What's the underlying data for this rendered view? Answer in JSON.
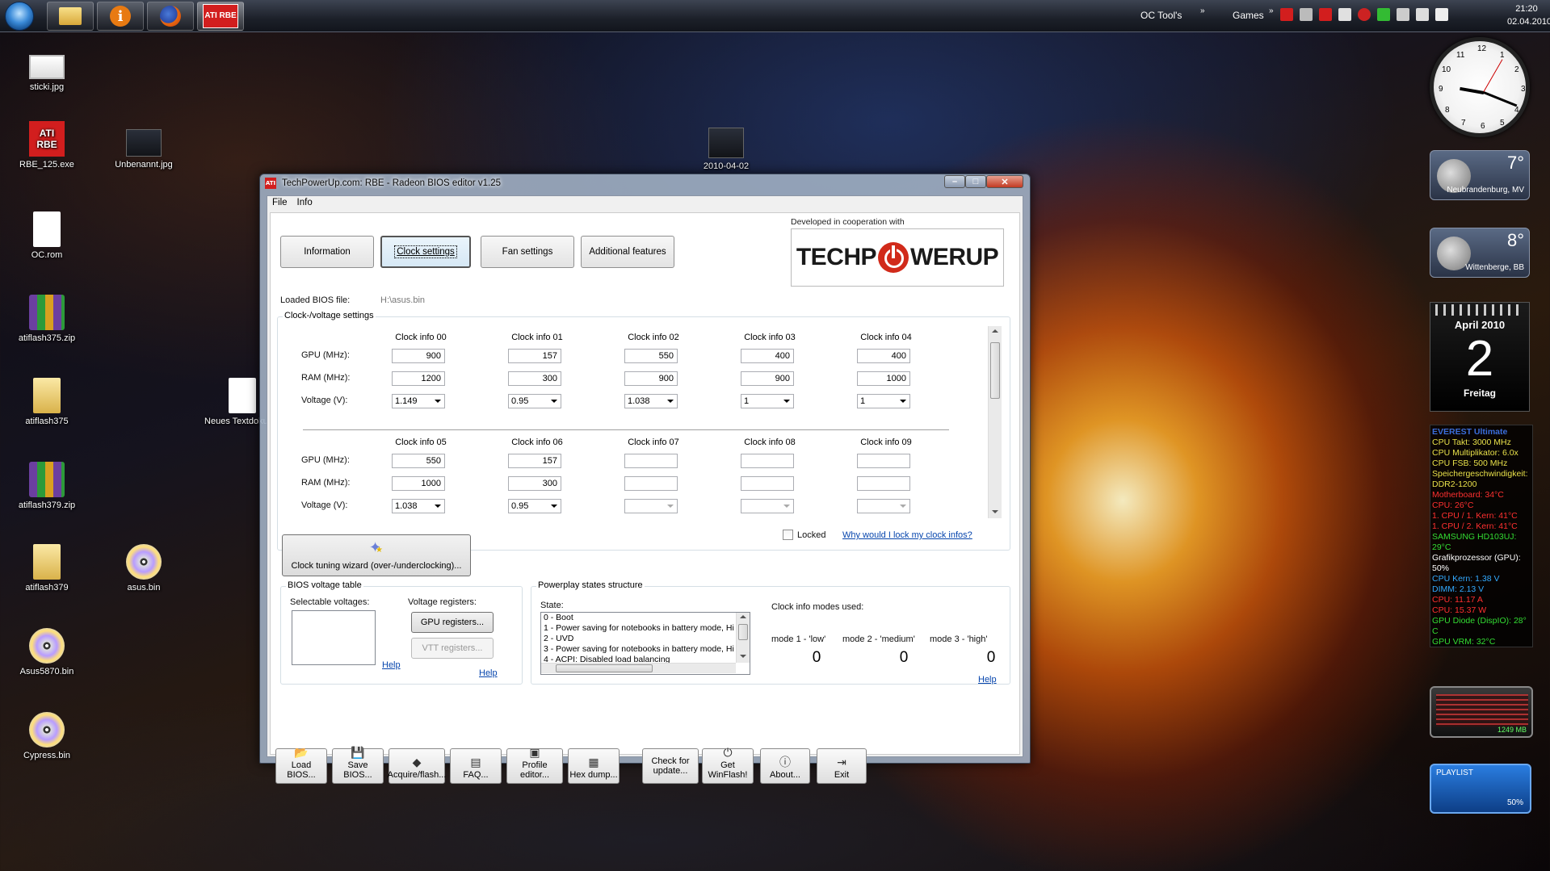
{
  "taskbar": {
    "tray_label_1": "OC Tool's",
    "tray_label_2": "Games",
    "time": "21:20",
    "date": "02.04.2010",
    "ati_icon_text": "ATI RBE"
  },
  "desktop_icons": [
    {
      "label": "sticki.jpg"
    },
    {
      "label": "RBE_125.exe"
    },
    {
      "label": "Unbenannt.jpg"
    },
    {
      "label": "OC.rom"
    },
    {
      "label": "atiflash375.zip"
    },
    {
      "label": "atiflash375"
    },
    {
      "label": "Neues Textdokume"
    },
    {
      "label": "atiflash379.zip"
    },
    {
      "label": "atiflash379"
    },
    {
      "label": "asus.bin"
    },
    {
      "label": "Asus5870.bin"
    },
    {
      "label": "Cypress.bin"
    },
    {
      "label": "2010-04-02"
    }
  ],
  "gadgets": {
    "weather_1": {
      "temp": "7°",
      "city": "Neubrandenburg, MV"
    },
    "weather_2": {
      "temp": "8°",
      "city": "Wittenberge, BB"
    },
    "calendar": {
      "month": "April 2010",
      "day": "2",
      "weekday": "Freitag"
    },
    "everest": {
      "title": "EVEREST Ultimate",
      "rows": [
        {
          "text": "CPU Takt: 3000 MHz",
          "color": "#e8e04a"
        },
        {
          "text": "CPU Multiplikator: 6.0x",
          "color": "#e8e04a"
        },
        {
          "text": "CPU FSB: 500 MHz",
          "color": "#e8e04a"
        },
        {
          "text": "Speichergeschwindigkeit:",
          "color": "#e8e04a"
        },
        {
          "text": "DDR2-1200",
          "color": "#e8e04a"
        },
        {
          "text": "Motherboard: 34°C",
          "color": "#ff3030"
        },
        {
          "text": "CPU: 26°C",
          "color": "#ff3030"
        },
        {
          "text": "1. CPU / 1. Kern: 41°C",
          "color": "#ff3030"
        },
        {
          "text": "1. CPU / 2. Kern: 41°C",
          "color": "#ff3030"
        },
        {
          "text": "SAMSUNG HD103UJ:",
          "color": "#33dd33"
        },
        {
          "text": "29°C",
          "color": "#33dd33"
        },
        {
          "text": "Grafikprozessor (GPU):",
          "color": "#ffffff"
        },
        {
          "text": "50%",
          "color": "#ffffff"
        },
        {
          "text": "CPU Kern: 1.38 V",
          "color": "#33aaff"
        },
        {
          "text": "DIMM: 2.13 V",
          "color": "#33aaff"
        },
        {
          "text": "CPU: 11.17 A",
          "color": "#ff3030"
        },
        {
          "text": "CPU: 15.37 W",
          "color": "#ff3030"
        },
        {
          "text": "GPU Diode (DispIO): 28°",
          "color": "#33dd33"
        },
        {
          "text": "C",
          "color": "#33dd33"
        },
        {
          "text": "GPU VRM: 32°C",
          "color": "#33dd33"
        }
      ]
    },
    "cpu_meter": {
      "label": "1249 MB"
    },
    "playlist": {
      "label": "PLAYLIST",
      "percent": "50%"
    }
  },
  "window": {
    "title": "TechPowerUp.com: RBE - Radeon BIOS editor v1.25",
    "title_icon_text": "ATI",
    "controls": {
      "min": "–",
      "max": "□",
      "close": "✕"
    },
    "menu": [
      "File",
      "Info"
    ],
    "tabs": [
      "Information",
      "Clock settings",
      "Fan settings",
      "Additional features"
    ],
    "tpu_caption": "Developed in cooperation with",
    "tpu_logo_left": "TECHP",
    "tpu_logo_right": "WERUP",
    "loaded_bios_label": "Loaded BIOS file:",
    "loaded_bios_path": "H:\\asus.bin",
    "clock_group_caption": "Clock-/voltage settings",
    "row_labels": {
      "gpu": "GPU (MHz):",
      "ram": "RAM (MHz):",
      "voltage": "Voltage (V):"
    },
    "clock_rows": [
      {
        "headers": [
          "Clock info 00",
          "Clock info 01",
          "Clock info 02",
          "Clock info 03",
          "Clock info 04"
        ],
        "gpu": [
          "900",
          "157",
          "550",
          "400",
          "400"
        ],
        "ram": [
          "1200",
          "300",
          "900",
          "900",
          "1000"
        ],
        "voltage": [
          "1.149",
          "0.95",
          "1.038",
          "1",
          "1"
        ]
      },
      {
        "headers": [
          "Clock info 05",
          "Clock info 06",
          "Clock info 07",
          "Clock info 08",
          "Clock info 09"
        ],
        "gpu": [
          "550",
          "157",
          "",
          "",
          ""
        ],
        "ram": [
          "1000",
          "300",
          "",
          "",
          ""
        ],
        "voltage": [
          "1.038",
          "0.95",
          "",
          "",
          ""
        ]
      }
    ],
    "locked_label": "Locked",
    "lock_link": "Why would I lock my clock infos?",
    "wizard_label": "Clock tuning wizard (over-/underclocking)...",
    "bios_voltage_caption": "BIOS voltage table",
    "selectable_voltages": "Selectable voltages:",
    "voltage_registers": "Voltage registers:",
    "gpu_registers": "GPU registers...",
    "vtt_registers": "VTT registers...",
    "help": "Help",
    "powerplay_caption": "Powerplay states structure",
    "state_label": "State:",
    "states": [
      "0 - Boot",
      "1 - Power saving for notebooks in battery mode, Hi",
      "2 - UVD",
      "3 - Power saving for notebooks in battery mode, Hi",
      "4 - ACPI: Disabled load balancing"
    ],
    "clock_modes_label": "Clock info modes used:",
    "modes": [
      {
        "label": "mode 1 - 'low'",
        "value": "0"
      },
      {
        "label": "mode 2 - 'medium'",
        "value": "0"
      },
      {
        "label": "mode 3 - 'high'",
        "value": "0"
      }
    ],
    "toolbar": [
      {
        "label": "Load BIOS...",
        "icon": "📂",
        "icon_name": "open-folder-icon"
      },
      {
        "label": "Save BIOS...",
        "icon": "💾",
        "icon_name": "floppy-disk-icon"
      },
      {
        "label": "Acquire/flash...",
        "icon": "◆",
        "icon_name": "chip-icon"
      },
      {
        "label": "FAQ...",
        "icon": "▤",
        "icon_name": "document-icon"
      },
      {
        "label": "Profile editor...",
        "icon": "▣",
        "icon_name": "ati-logo-icon"
      },
      {
        "label": "Hex dump...",
        "icon": "▦",
        "icon_name": "hex-grid-icon"
      },
      {
        "label": "Check for update...",
        "icon": "",
        "icon_name": ""
      },
      {
        "label": "Get WinFlash!",
        "icon": "⏻",
        "icon_name": "power-icon"
      },
      {
        "label": "About...",
        "icon": "ⓘ",
        "icon_name": "info-icon"
      },
      {
        "label": "Exit",
        "icon": "⇥",
        "icon_name": "exit-door-icon"
      }
    ]
  }
}
